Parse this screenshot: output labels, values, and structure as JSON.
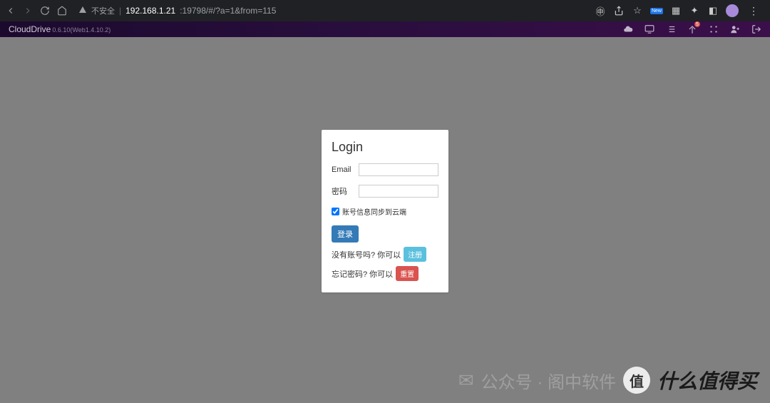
{
  "browser": {
    "insecure_label": "不安全",
    "url_host": "192.168.1.21",
    "url_path": ":19798/#/?a=1&from=115"
  },
  "header": {
    "brand": "CloudDrive",
    "version": "0.6.10(Web1.4.10.2)",
    "notification_count": "5"
  },
  "login": {
    "title": "Login",
    "email_label": "Email",
    "password_label": "密码",
    "sync_checkbox_label": "账号信息同步到云端",
    "login_button": "登录",
    "no_account_text": "没有账号吗? 你可以",
    "register_button": "注册",
    "forgot_text": "忘记密码? 你可以",
    "reset_button": "重置"
  },
  "watermark": {
    "wechat_text": "公众号 · 阁中软件",
    "badge_char": "值",
    "slogan": "什么值得买"
  }
}
